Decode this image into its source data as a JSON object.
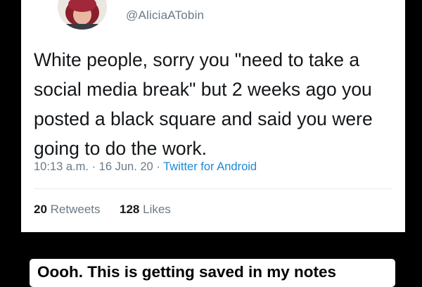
{
  "tweet": {
    "handle": "@AliciaATobin",
    "text": "White people, sorry you \"need to take a social media break\" but 2 weeks ago you posted a black square and said you were going to do the work.",
    "time": "10:13 a.m.",
    "date": "16 Jun. 20",
    "source": "Twitter for Android",
    "separator": "·",
    "retweet_count": "20",
    "retweet_label": "Retweets",
    "like_count": "128",
    "like_label": "Likes"
  },
  "caption": {
    "text": "Oooh. This is getting saved in my notes"
  }
}
